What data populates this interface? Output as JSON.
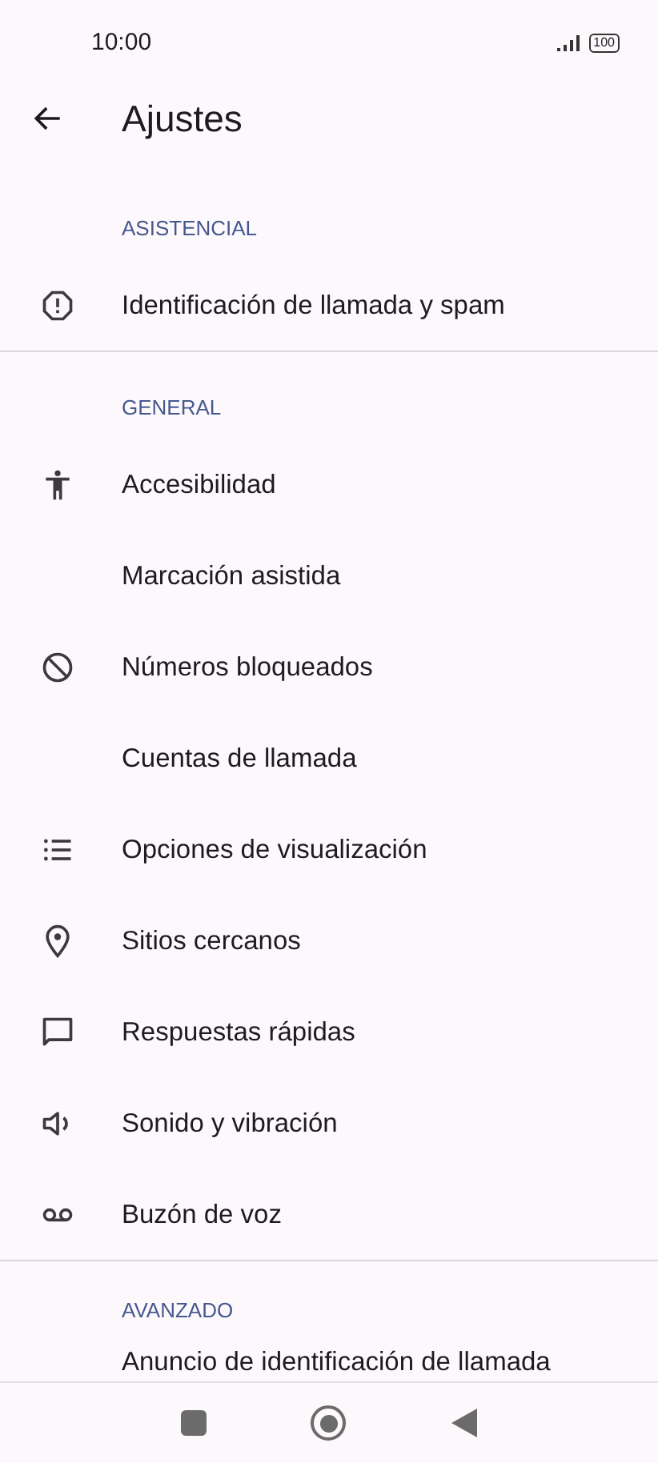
{
  "status_bar": {
    "time": "10:00",
    "battery": "100"
  },
  "app_bar": {
    "title": "Ajustes"
  },
  "sections": [
    {
      "header": "ASISTENCIAL",
      "items": [
        {
          "label": "Identificación de llamada y spam"
        }
      ]
    },
    {
      "header": "GENERAL",
      "items": [
        {
          "label": "Accesibilidad"
        },
        {
          "label": "Marcación asistida"
        },
        {
          "label": "Números bloqueados"
        },
        {
          "label": "Cuentas de llamada"
        },
        {
          "label": "Opciones de visualización"
        },
        {
          "label": "Sitios cercanos"
        },
        {
          "label": "Respuestas rápidas"
        },
        {
          "label": "Sonido y vibración"
        },
        {
          "label": "Buzón de voz"
        }
      ]
    },
    {
      "header": "AVANZADO",
      "items": [
        {
          "label": "Anuncio de identificación de llamada"
        }
      ]
    }
  ]
}
